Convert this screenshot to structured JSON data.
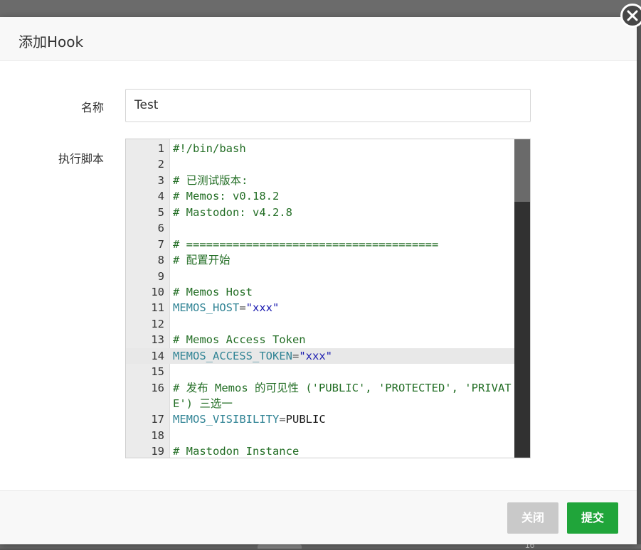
{
  "background": {
    "partial_number": "16"
  },
  "dialog": {
    "title": "添加Hook",
    "close_icon": "close-icon"
  },
  "form": {
    "name_label": "名称",
    "name_value": "Test",
    "script_label": "执行脚本"
  },
  "editor": {
    "active_line": 14,
    "lines": [
      {
        "n": "1",
        "tokens": [
          {
            "t": "#!/bin/bash",
            "c": "comment"
          }
        ]
      },
      {
        "n": "2",
        "tokens": []
      },
      {
        "n": "3",
        "tokens": [
          {
            "t": "# 已测试版本:",
            "c": "comment"
          }
        ]
      },
      {
        "n": "4",
        "tokens": [
          {
            "t": "# Memos: v0.18.2",
            "c": "comment"
          }
        ]
      },
      {
        "n": "5",
        "tokens": [
          {
            "t": "# Mastodon: v4.2.8",
            "c": "comment"
          }
        ]
      },
      {
        "n": "6",
        "tokens": []
      },
      {
        "n": "7",
        "tokens": [
          {
            "t": "# ======================================",
            "c": "comment"
          }
        ]
      },
      {
        "n": "8",
        "tokens": [
          {
            "t": "# 配置开始",
            "c": "comment"
          }
        ]
      },
      {
        "n": "9",
        "tokens": []
      },
      {
        "n": "10",
        "tokens": [
          {
            "t": "# Memos Host",
            "c": "comment"
          }
        ]
      },
      {
        "n": "11",
        "tokens": [
          {
            "t": "MEMOS_HOST",
            "c": "var"
          },
          {
            "t": "=",
            "c": "op"
          },
          {
            "t": "\"xxx\"",
            "c": "str"
          }
        ]
      },
      {
        "n": "12",
        "tokens": []
      },
      {
        "n": "13",
        "tokens": [
          {
            "t": "# Memos Access Token",
            "c": "comment"
          }
        ]
      },
      {
        "n": "14",
        "tokens": [
          {
            "t": "MEMOS_ACCESS_TOKEN",
            "c": "var"
          },
          {
            "t": "=",
            "c": "op"
          },
          {
            "t": "\"xxx\"",
            "c": "str"
          }
        ]
      },
      {
        "n": "15",
        "tokens": []
      },
      {
        "n": "16",
        "wrap": true,
        "tokens": [
          {
            "t": "# 发布 Memos 的可见性 ('PUBLIC', 'PROTECTED', 'PRIVATE') 三选一",
            "c": "comment"
          }
        ]
      },
      {
        "n": "17",
        "tokens": [
          {
            "t": "MEMOS_VISIBILITY",
            "c": "var"
          },
          {
            "t": "=",
            "c": "op"
          },
          {
            "t": "PUBLIC",
            "c": "plain"
          }
        ]
      },
      {
        "n": "18",
        "tokens": []
      },
      {
        "n": "19",
        "tokens": [
          {
            "t": "# Mastodon Instance",
            "c": "comment"
          }
        ]
      }
    ]
  },
  "footer": {
    "cancel_label": "关闭",
    "submit_label": "提交"
  }
}
